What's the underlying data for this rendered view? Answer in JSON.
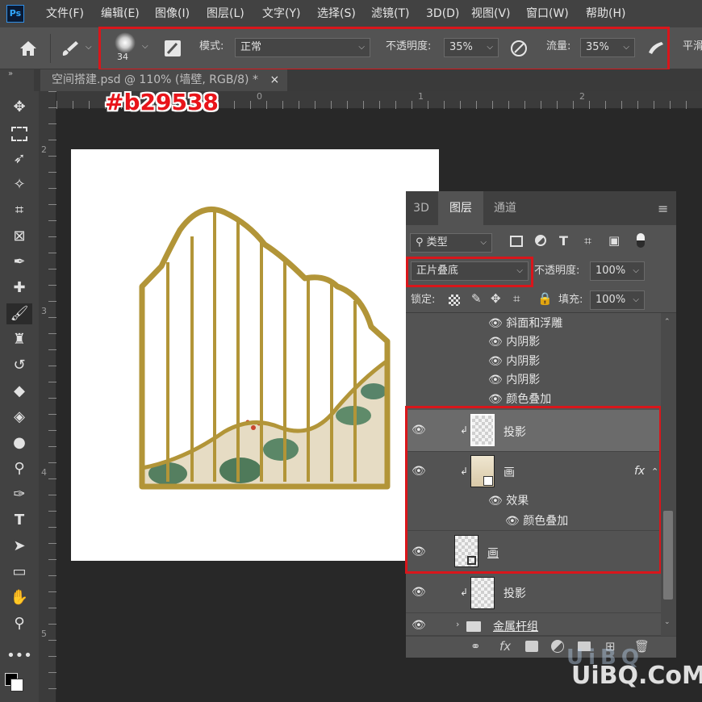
{
  "app": {
    "logo": "Ps"
  },
  "menu": [
    "文件(F)",
    "编辑(E)",
    "图像(I)",
    "图层(L)",
    "文字(Y)",
    "选择(S)",
    "滤镜(T)",
    "3D(D)",
    "视图(V)",
    "窗口(W)",
    "帮助(H)"
  ],
  "options": {
    "brush_size": "34",
    "mode_label": "模式:",
    "mode_value": "正常",
    "opacity_label": "不透明度:",
    "opacity_value": "35%",
    "flow_label": "流量:",
    "flow_value": "35%",
    "smooth_label": "平滑"
  },
  "document": {
    "tab_title": "空间搭建.psd @ 110% (墙壁, RGB/8) *",
    "close": "×"
  },
  "annotation": {
    "color_text": "#b29538",
    "color": "#b29538",
    "red": "#d9161b"
  },
  "rulers": {
    "h": [
      "0",
      "1",
      "2"
    ],
    "v": [
      "2",
      "3",
      "4",
      "5"
    ]
  },
  "layers_panel": {
    "tabs": [
      "3D",
      "图层",
      "通道"
    ],
    "filter_label": "类型",
    "blend_mode": "正片叠底",
    "opacity_label": "不透明度:",
    "opacity_value": "100%",
    "lock_label": "锁定:",
    "fill_label": "填充:",
    "fill_value": "100%",
    "effects_top": [
      "斜面和浮雕",
      "内阴影",
      "内阴影",
      "内阴影",
      "颜色叠加"
    ],
    "layers": [
      {
        "name": "投影",
        "selected": true
      },
      {
        "name": "画",
        "fx": "fx",
        "effects_label": "效果",
        "effects": [
          "颜色叠加"
        ]
      },
      {
        "name": "画"
      },
      {
        "name": "投影"
      },
      {
        "name": "金属杆组"
      }
    ]
  },
  "watermark": {
    "line1": "UiBQ",
    "line2": "UiBQ.CoM"
  }
}
